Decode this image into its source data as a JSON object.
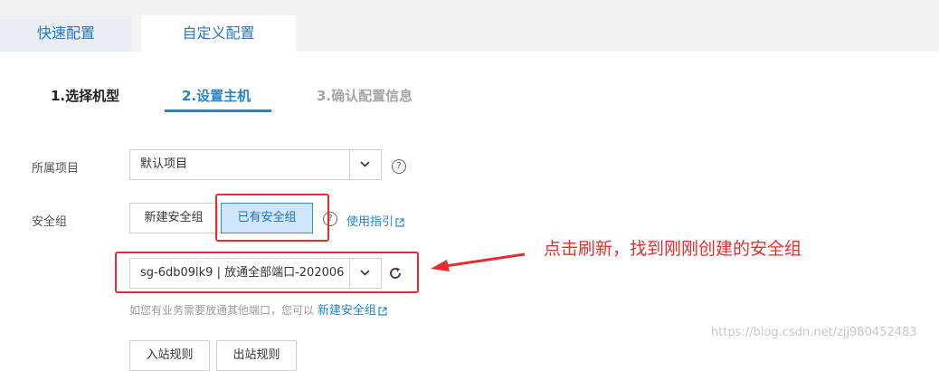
{
  "tabs": {
    "quick": "快速配置",
    "custom": "自定义配置"
  },
  "steps": {
    "step1": "1.选择机型",
    "step2": "2.设置主机",
    "step3": "3.确认配置信息"
  },
  "project": {
    "label": "所属项目",
    "value": "默认项目",
    "help": "?"
  },
  "security_group": {
    "label": "安全组",
    "new_button": "新建安全组",
    "existing_button": "已有安全组",
    "help": "?",
    "guide_link": "使用指引",
    "selected": "sg-6db09lk9 | 放通全部端口-202006",
    "hint_text": "如您有业务需要放通其他端口，您可以",
    "hint_link": "新建安全组"
  },
  "rules": {
    "inbound": "入站规则",
    "outbound": "出站规则"
  },
  "annotation": "点击刷新，找到刚刚创建的安全组",
  "watermark": "https://blog.csdn.net/zjj980452483",
  "colors": {
    "accent": "#1e86d6",
    "annotation_red": "#e52d2d",
    "selected_bg": "#cfe6fb"
  }
}
